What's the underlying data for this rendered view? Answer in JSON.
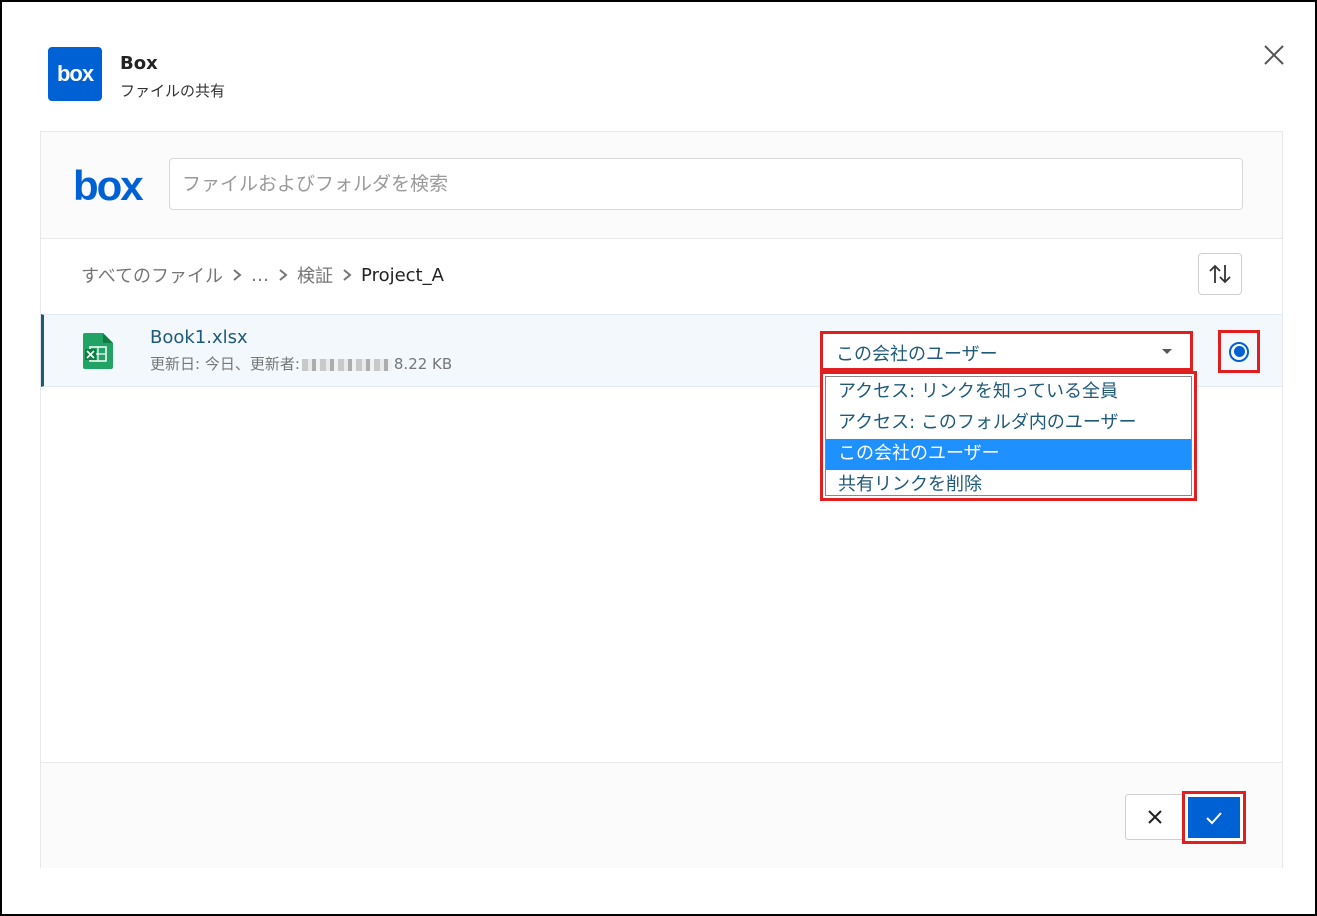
{
  "dialog": {
    "app_name": "Box",
    "subtitle": "ファイルの共有",
    "logo_text": "box",
    "close_icon": "close-icon"
  },
  "picker": {
    "logo_text": "box",
    "search": {
      "placeholder": "ファイルおよびフォルダを検索",
      "value": ""
    },
    "breadcrumb": {
      "items": [
        "すべてのファイル",
        "…",
        "検証",
        "Project_A"
      ]
    },
    "sort_icon": "sort-up-down-icon",
    "file": {
      "name": "Book1.xlsx",
      "meta_prefix": "更新日: 今日、更新者:",
      "size": "8.22 KB",
      "icon": "excel-file-icon",
      "access_select": {
        "value": "この会社のユーザー",
        "options": [
          "アクセス: リンクを知っている全員",
          "アクセス: このフォルダ内のユーザー",
          "この会社のユーザー",
          "共有リンクを削除"
        ],
        "selected_index": 2
      },
      "radio_selected": true
    },
    "footer": {
      "cancel_icon": "close-icon",
      "confirm_icon": "checkmark-icon"
    }
  },
  "colors": {
    "brand": "#0061d5",
    "highlight_border": "#e02020",
    "selected_option": "#1e90ff",
    "file_text": "#1f5a7a"
  }
}
